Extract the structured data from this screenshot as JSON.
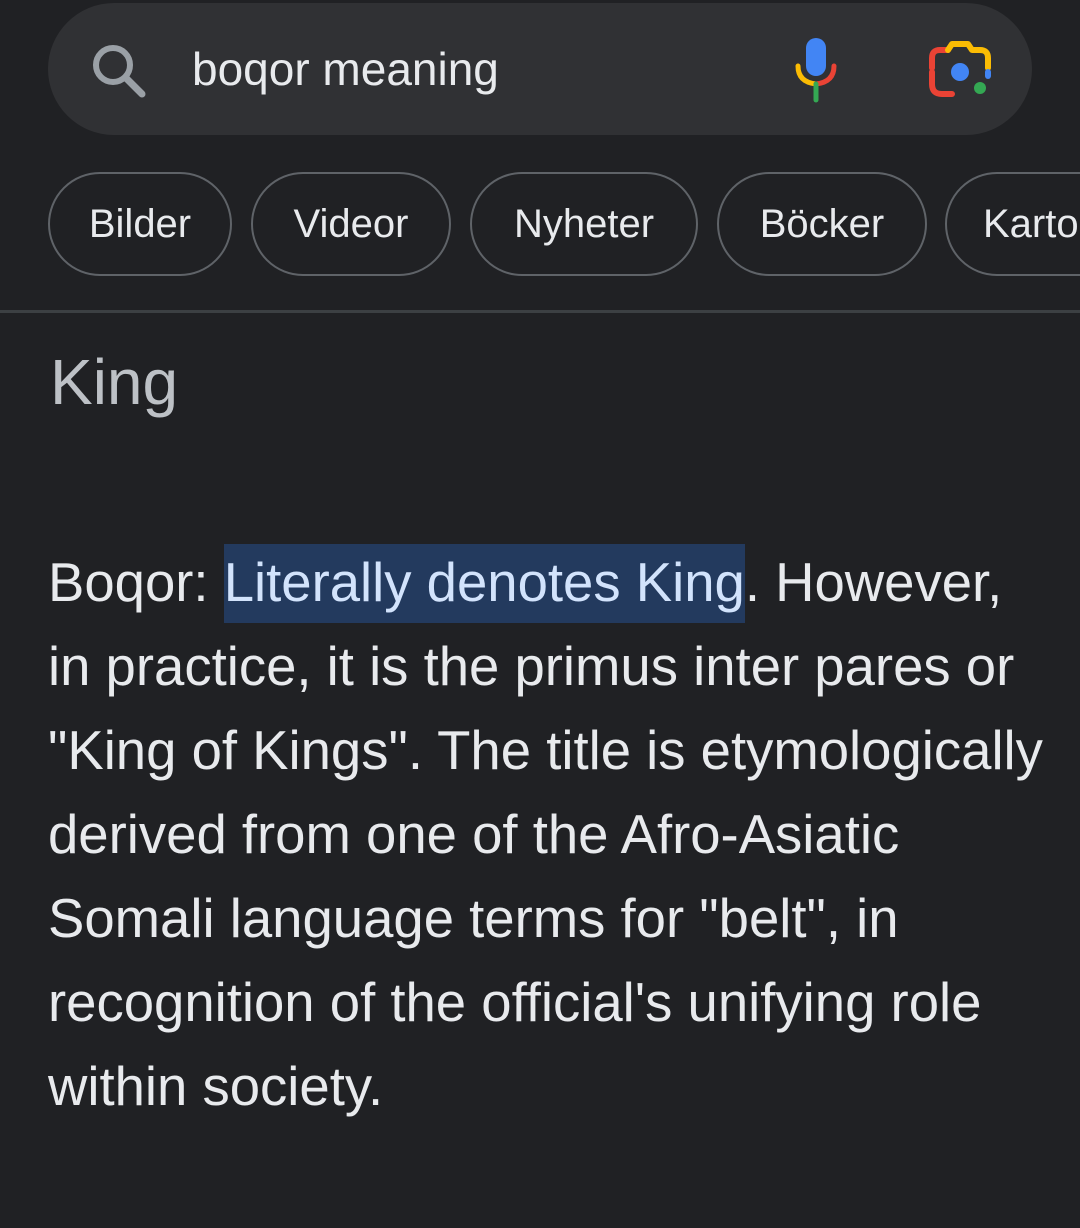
{
  "search": {
    "query": "boqor meaning",
    "search_icon": "search-icon",
    "mic_icon": "mic-icon",
    "lens_icon": "camera-lens-icon"
  },
  "chips": [
    {
      "label": "Bilder"
    },
    {
      "label": "Videor"
    },
    {
      "label": "Nyheter"
    },
    {
      "label": "Böcker"
    },
    {
      "label": "Karto"
    }
  ],
  "answer": {
    "title": "King",
    "term_prefix": "Boqor: ",
    "highlighted": "Literally denotes King",
    "rest": ". However, in practice, it is the primus inter pares or \"King of Kings\". The title is etymologically derived from one of the Afro-Asiatic Somali language terms for \"belt\", in recognition of the official's unifying role within society."
  },
  "colors": {
    "background": "#202124",
    "search_bar": "#303134",
    "chip_border": "#5f6368",
    "highlight_bg": "#233a5e",
    "google_blue": "#4285f4",
    "google_red": "#ea4335",
    "google_yellow": "#fbbc04",
    "google_green": "#34a853"
  }
}
